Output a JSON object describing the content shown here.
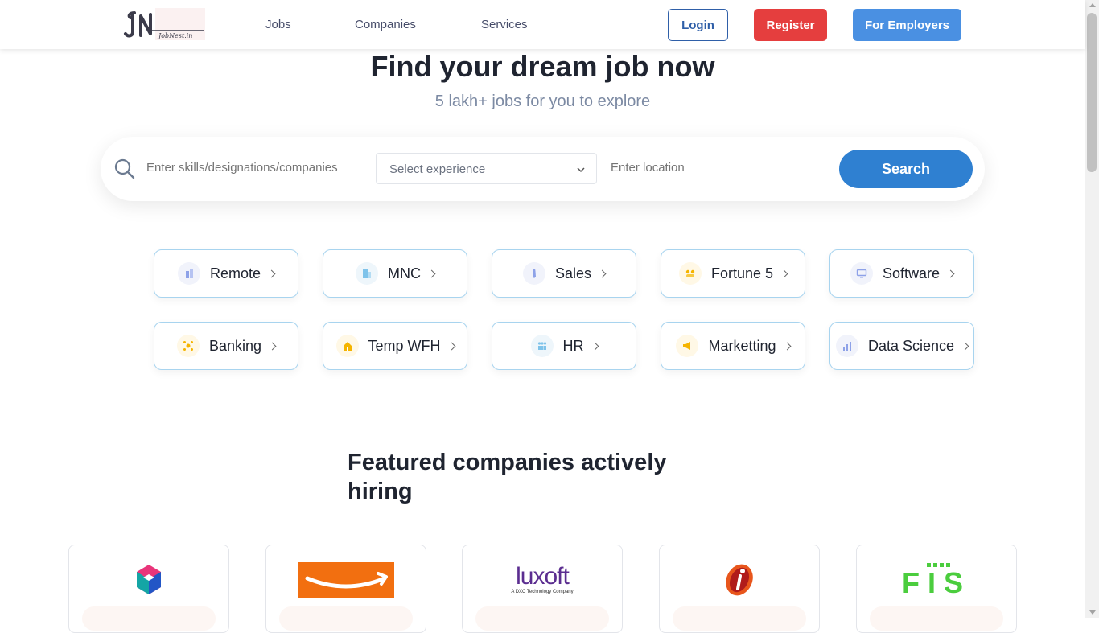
{
  "header": {
    "logo_text": "JobNest.in",
    "nav": [
      {
        "label": "Jobs"
      },
      {
        "label": "Companies"
      },
      {
        "label": "Services"
      }
    ],
    "login_label": "Login",
    "register_label": "Register",
    "employers_label": "For Employers"
  },
  "hero": {
    "title": "Find your dream job now",
    "subtitle": "5 lakh+ jobs for you to explore"
  },
  "search": {
    "skills_placeholder": "Enter skills/designations/companies",
    "experience_placeholder": "Select experience",
    "location_placeholder": "Enter location",
    "button_label": "Search"
  },
  "categories": [
    {
      "label": "Remote",
      "icon": "building-icon"
    },
    {
      "label": "MNC",
      "icon": "office-icon"
    },
    {
      "label": "Sales",
      "icon": "tie-icon"
    },
    {
      "label": "Fortune 5",
      "icon": "group-icon"
    },
    {
      "label": "Software",
      "icon": "monitor-icon"
    },
    {
      "label": "Banking",
      "icon": "network-icon"
    },
    {
      "label": "Temp WFH",
      "icon": "house-icon"
    },
    {
      "label": "HR",
      "icon": "people-icon"
    },
    {
      "label": "Marketting",
      "icon": "megaphone-icon"
    },
    {
      "label": "Data Science",
      "icon": "bar-chart-icon"
    }
  ],
  "featured": {
    "title": "Featured companies actively hiring",
    "companies": [
      {
        "logo": "cube-logo"
      },
      {
        "logo": "amazon-logo"
      },
      {
        "logo": "luxoft-logo",
        "name": "luxoft",
        "tagline": "A DXC Technology Company"
      },
      {
        "logo": "icici-logo"
      },
      {
        "logo": "fis-logo",
        "name": "FIS"
      }
    ]
  },
  "colors": {
    "primary": "#2f80d1",
    "register": "#e53e3e",
    "employers": "#4a90e2",
    "chip_border": "#a8d4ef"
  }
}
